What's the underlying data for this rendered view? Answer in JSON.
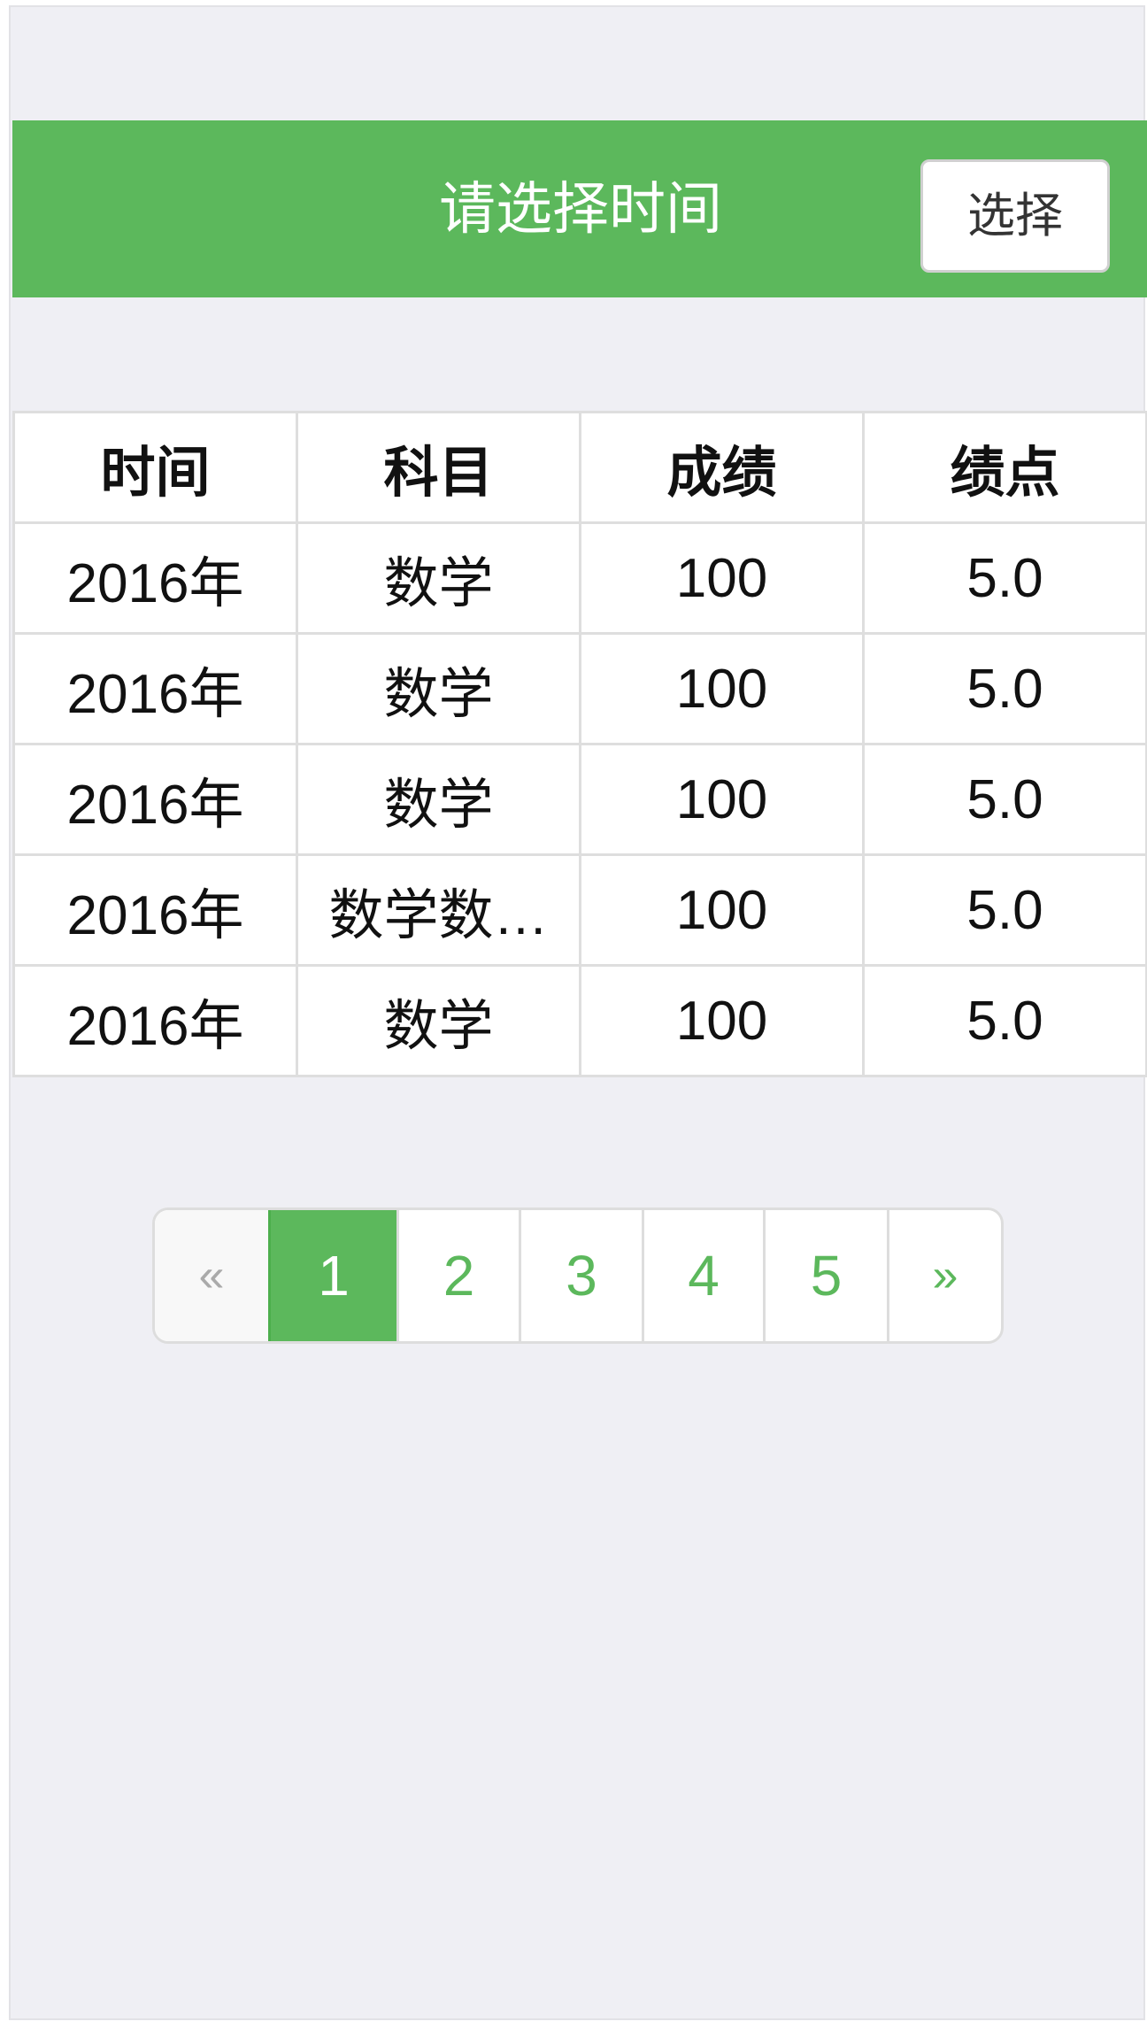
{
  "header": {
    "title": "请选择时间",
    "select_button": "选择"
  },
  "table": {
    "columns": [
      "时间",
      "科目",
      "成绩",
      "绩点"
    ],
    "rows": [
      [
        "2016年",
        "数学",
        "100",
        "5.0"
      ],
      [
        "2016年",
        "数学",
        "100",
        "5.0"
      ],
      [
        "2016年",
        "数学",
        "100",
        "5.0"
      ],
      [
        "2016年",
        "数学数…",
        "100",
        "5.0"
      ],
      [
        "2016年",
        "数学",
        "100",
        "5.0"
      ]
    ]
  },
  "pagination": {
    "prev": "«",
    "pages": [
      "1",
      "2",
      "3",
      "4",
      "5"
    ],
    "next": "»",
    "active_page": "1"
  },
  "colors": {
    "accent": "#5cb85c",
    "background": "#efeff4"
  }
}
